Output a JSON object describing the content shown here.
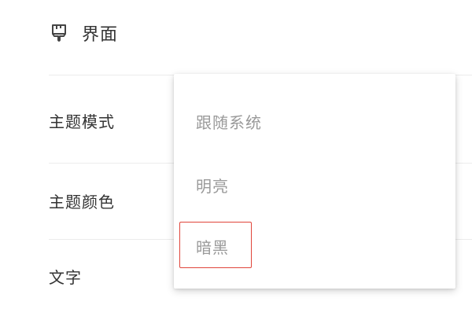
{
  "section": {
    "title": "界面",
    "icon": "brush-icon"
  },
  "settings": [
    {
      "label": "主题模式"
    },
    {
      "label": "主题颜色"
    },
    {
      "label": "文字"
    }
  ],
  "dropdown": {
    "options": [
      {
        "label": "跟随系统"
      },
      {
        "label": "明亮"
      },
      {
        "label": "暗黑",
        "highlighted": true
      }
    ]
  },
  "colors": {
    "highlight": "#e0453a",
    "text": "#333333",
    "option_text": "#9a9a9a"
  }
}
